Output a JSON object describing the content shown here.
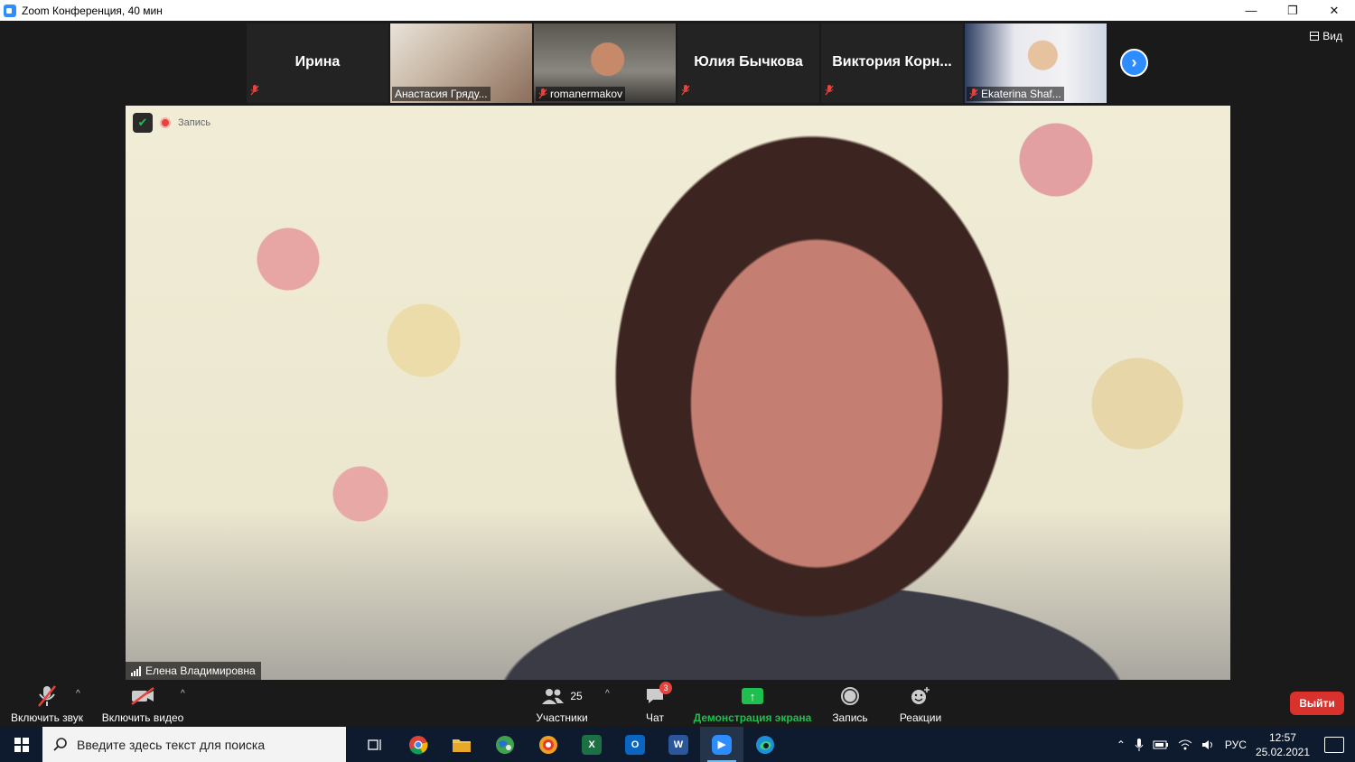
{
  "window": {
    "title": "Zoom Конференция, 40 мин",
    "controls": {
      "minimize": "—",
      "restore": "❐",
      "close": "✕"
    }
  },
  "thumbnails": [
    {
      "name": "Ирина",
      "type": "name-only",
      "muted": true
    },
    {
      "name": "Анастасия Гряду...",
      "type": "video",
      "muted": false
    },
    {
      "name": "romanermakov",
      "type": "video",
      "muted": true
    },
    {
      "name": "Юлия Бычкова",
      "type": "name-only",
      "muted": true
    },
    {
      "name": "Виктория Корн...",
      "type": "name-only",
      "muted": true
    },
    {
      "name": "Ekaterina Shaf...",
      "type": "video",
      "muted": true
    }
  ],
  "view_button": {
    "label": "Вид"
  },
  "main_video": {
    "recording_label": "Запись",
    "speaker_name": "Елена Владимировна"
  },
  "toolbar": {
    "unmute_label": "Включить звук",
    "video_label": "Включить видео",
    "participants_label": "Участники",
    "participants_count": "25",
    "chat_label": "Чат",
    "chat_badge": "3",
    "share_label": "Демонстрация экрана",
    "record_label": "Запись",
    "reactions_label": "Реакции",
    "leave_label": "Выйти"
  },
  "taskbar": {
    "search_placeholder": "Введите здесь текст для поиска",
    "language": "РУС",
    "time": "12:57",
    "date": "25.02.2021",
    "apps": [
      "task-view",
      "chrome",
      "file-explorer",
      "maps",
      "browser-app",
      "excel",
      "outlook",
      "word",
      "zoom",
      "edge"
    ]
  },
  "colors": {
    "zoom_blue": "#2d8cff",
    "share_green": "#1fbf4f",
    "leave_red": "#d9312b",
    "muted_red": "#e8423b",
    "taskbar_bg": "#0e1b2e"
  }
}
